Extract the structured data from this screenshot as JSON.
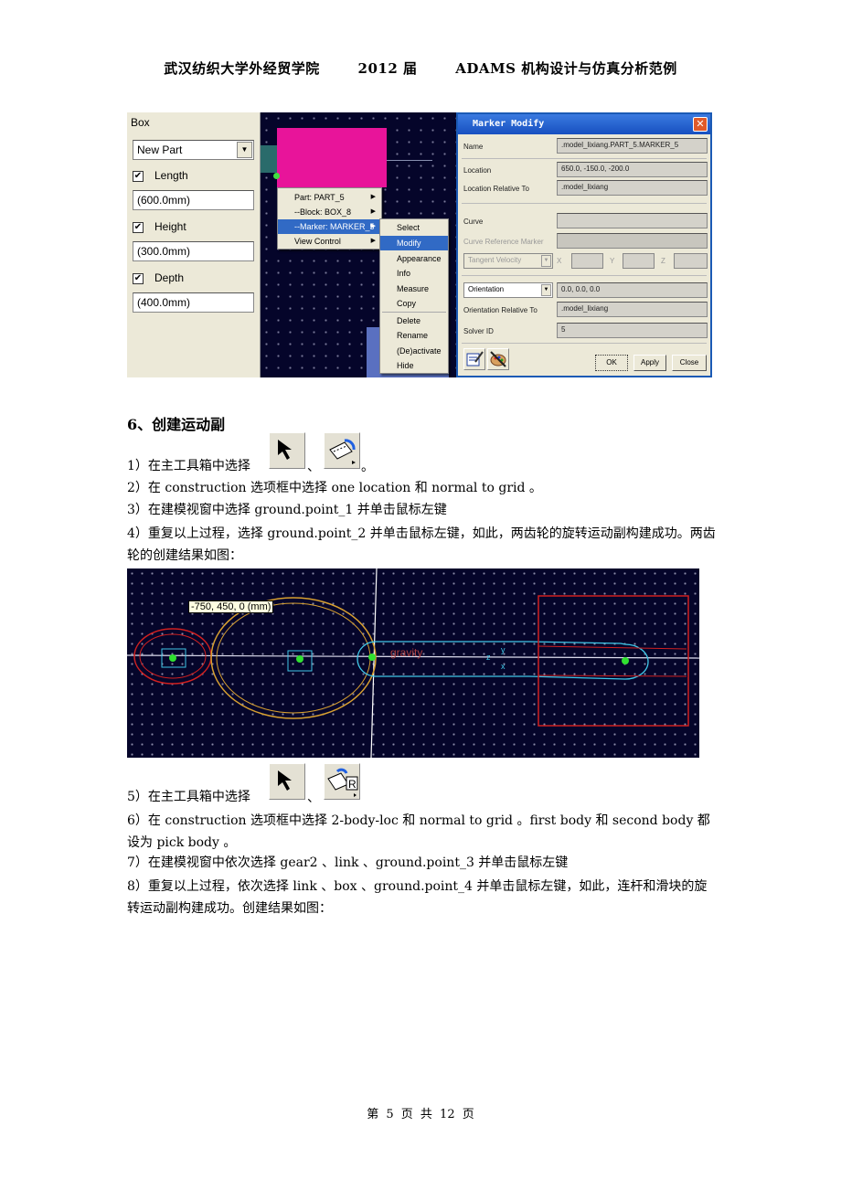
{
  "header": {
    "school": "武汉纺织大学外经贸学院",
    "year": "2012 届",
    "title": "ADAMS 机构设计与仿真分析范例"
  },
  "screenshot1": {
    "box_panel": {
      "title": "Box",
      "part_select": "New Part",
      "fields": [
        {
          "label": "Length",
          "checked": true,
          "value": "(600.0mm)"
        },
        {
          "label": "Height",
          "checked": true,
          "value": "(300.0mm)"
        },
        {
          "label": "Depth",
          "checked": true,
          "value": "(400.0mm)"
        }
      ]
    },
    "context_menu": {
      "items": [
        {
          "label": "Part: PART_5",
          "submenu": true
        },
        {
          "label": "--Block: BOX_8",
          "submenu": true
        },
        {
          "label": "--Marker: MARKER_5",
          "submenu": true,
          "selected": true
        },
        {
          "label": "View Control",
          "submenu": true
        }
      ],
      "submenu": [
        {
          "label": "Select"
        },
        {
          "label": "Modify",
          "selected": true
        },
        {
          "label": "Appearance"
        },
        {
          "label": "Info"
        },
        {
          "label": "Measure"
        },
        {
          "label": "Copy"
        },
        {
          "label": "Delete"
        },
        {
          "label": "Rename"
        },
        {
          "label": "(De)activate"
        },
        {
          "label": "Hide"
        }
      ]
    },
    "dialog": {
      "title": "Marker Modify",
      "name_label": "Name",
      "name_value": ".model_lixiang.PART_5.MARKER_5",
      "location_label": "Location",
      "location_value": "650.0, -150.0, -200.0",
      "location_rel_label": "Location Relative To",
      "location_rel_value": ".model_lixiang",
      "curve_label": "Curve",
      "curve_value": "",
      "curve_ref_label": "Curve Reference Marker",
      "tangent_select": "Tangent Velocity",
      "x_label": "X",
      "y_label": "Y",
      "z_label": "Z",
      "orientation_select": "Orientation",
      "orientation_value": "0.0, 0.0, 0.0",
      "orientation_rel_label": "Orientation Relative To",
      "orientation_rel_value": ".model_lixiang",
      "solver_label": "Solver ID",
      "solver_value": "5",
      "ok": "OK",
      "apply": "Apply",
      "close": "Close"
    }
  },
  "section": {
    "heading": "6、创建运动副",
    "steps": [
      {
        "pre": "1）在主工具箱中选择",
        "sep": "、",
        "post": "。"
      },
      {
        "text": "2）在 construction 选项框中选择 one location  和 normal to grid  。"
      },
      {
        "text": "3）在建模视窗中选择 ground.point_1 并单击鼠标左键"
      },
      {
        "text": "4）重复以上过程，选择 ground.point_2 并单击鼠标左键，如此，两齿轮的旋转运动副构建成功。两齿轮的创建结果如图："
      },
      {
        "pre": "5）在主工具箱中选择",
        "sep": "、",
        "post": ""
      },
      {
        "text": "6）在 construction 选项框中选择 2-body-loc 和 normal to grid  。first body  和 second body  都设为 pick body  。"
      },
      {
        "text": "7）在建模视窗中依次选择 gear2  、link  、ground.point_3 并单击鼠标左键"
      },
      {
        "text": "8）重复以上过程，依次选择 link  、box  、ground.point_4 并单击鼠标左键，如此，连杆和滑块的旋转运动副构建成功。创建结果如图："
      }
    ]
  },
  "screenshot2": {
    "coord_tooltip": "-750, 450, 0 (mm)",
    "gravity_label": "gravity",
    "axis_labels": [
      "y",
      "z",
      "x"
    ],
    "colors": {
      "gear1": "#d02020",
      "gear2": "#d8a030",
      "link": "#40c8e8",
      "box": "#d02020",
      "marker": "#30e030"
    }
  },
  "icons": {
    "select_tool": "arrow-cursor-icon",
    "revolute_joint": "revolute-joint-icon",
    "revolute_joint_r": "revolute-joint-2body-icon"
  },
  "footer": "第 5 页 共 12 页"
}
